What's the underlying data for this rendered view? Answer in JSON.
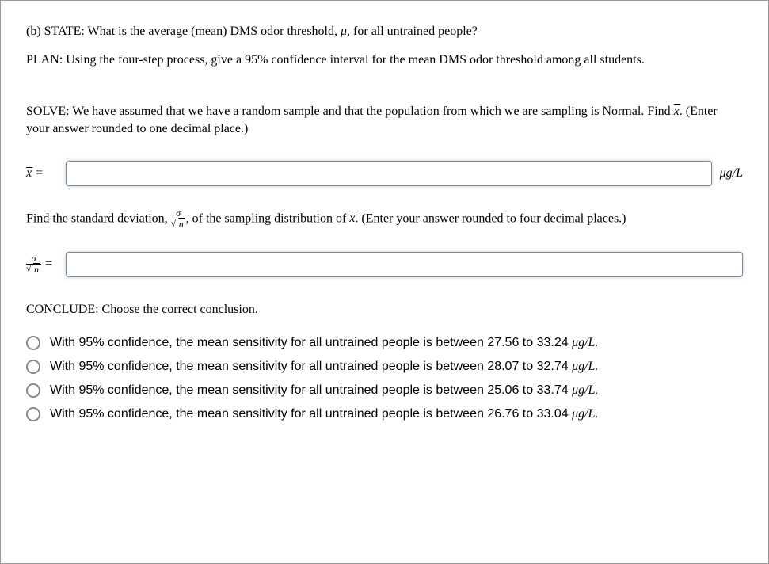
{
  "state": "(b) STATE: What is the average (mean) DMS odor threshold, ",
  "state_tail": ", for all untrained people?",
  "plan": "PLAN: Using the four-step process, give a 95% confidence interval for the mean DMS odor threshold among all students.",
  "solve1": "SOLVE: We have assumed that we have a random sample and that the population from which we are sampling is Normal. Find ",
  "solve1_tail": ". (Enter your answer rounded to one decimal place.)",
  "xbar_label": "x̄ =",
  "unit1": "μg/L",
  "stddev_pre": "Find the standard deviation, ",
  "stddev_post": ", of the sampling distribution of ",
  "stddev_tail": ". (Enter your answer rounded to four decimal places.)",
  "frac_label_eq": " =",
  "conclude": "CONCLUDE: Choose the correct conclusion.",
  "options": {
    "a_pre": "With 95% confidence, the mean sensitivity for all untrained people is between 27.56 to 33.24 ",
    "a_unit": "μg/L.",
    "b_pre": "With 95% confidence, the mean sensitivity for all untrained people is between 28.07 to 32.74 ",
    "b_unit": "μg/L.",
    "c_pre": "With 95% confidence, the mean sensitivity for all untrained people is between 25.06 to 33.74 ",
    "c_unit": "μg/L.",
    "d_pre": "With 95% confidence, the mean sensitivity for all untrained people is between 26.76 to 33.04 ",
    "d_unit": "μg/L."
  }
}
